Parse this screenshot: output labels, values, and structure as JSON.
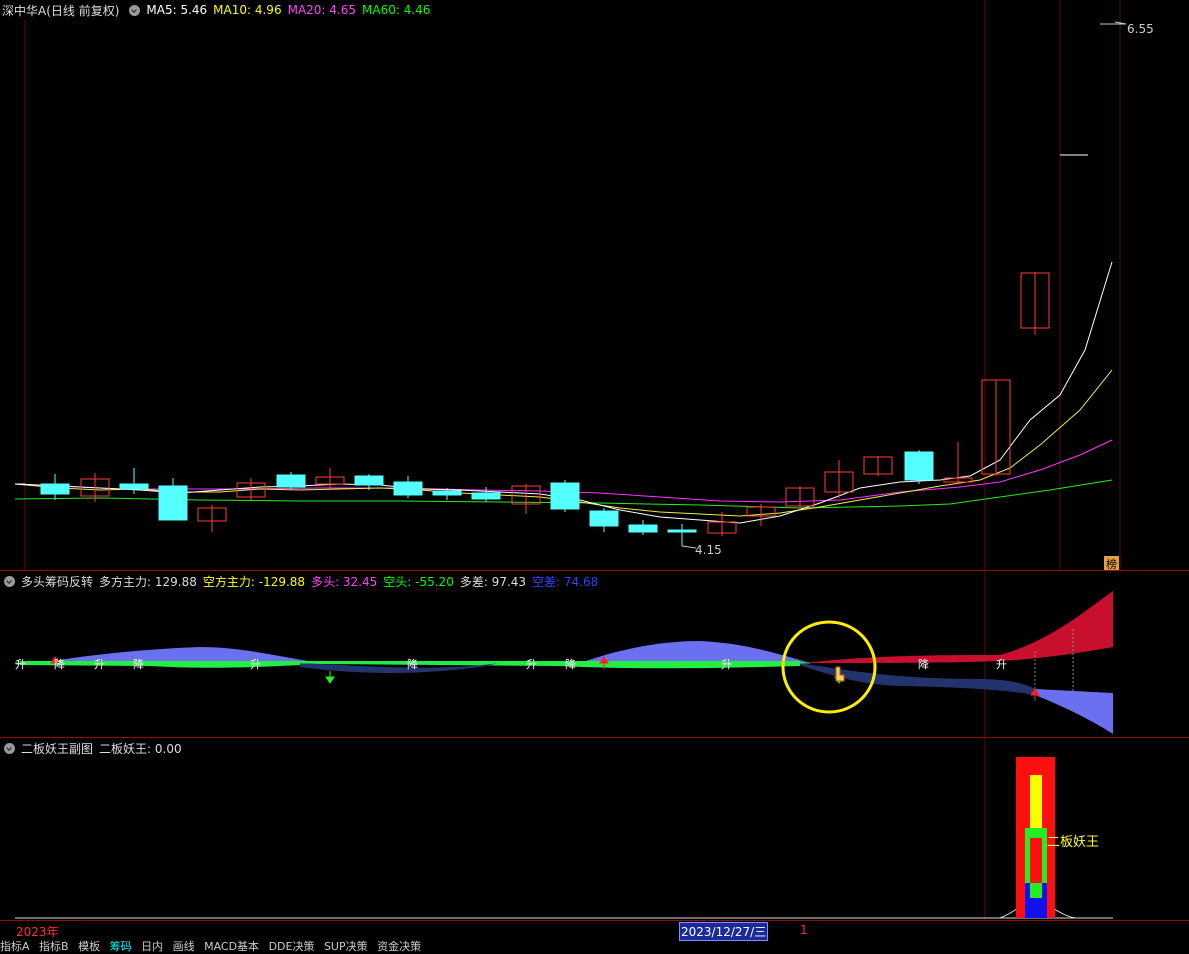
{
  "main_header": {
    "title": "深中华A(日线 前复权)",
    "ma5": "MA5: 5.46",
    "ma10": "MA10: 4.96",
    "ma20": "MA20: 4.65",
    "ma60": "MA60: 4.46"
  },
  "price_high_label": "6.55",
  "price_low_label": "4.15",
  "badge_label": "榜",
  "indicator1_header": {
    "title": "多头筹码反转",
    "duo_zhuli": "多方主力: 129.88",
    "kong_zhuli": "空方主力: -129.88",
    "duotou": "多头: 32.45",
    "kongtou": "空头: -55.20",
    "duocha": "多差: 97.43",
    "kongcha": "空差: 74.68"
  },
  "indicator2_header": {
    "title": "二板妖王副图",
    "value": "二板妖王: 0.00"
  },
  "erban_label": "二板妖王",
  "sheng_label": "升",
  "jiang_label": "降",
  "footer": {
    "year": "2023年",
    "date": "2023/12/27/三",
    "cursor": "1"
  },
  "tabs": [
    "指标A",
    "指标B",
    "模板",
    "筹码",
    "日内",
    "画线",
    "MACD基本",
    "DDE决策",
    "SUP决策",
    "资金决策"
  ],
  "colors": {
    "up_candle": "#ff3c3c",
    "down_candle": "#54ffff",
    "ma5": "#ffffff",
    "ma10": "#ffff00",
    "ma20": "#ff00ff",
    "ma60": "#00ff00",
    "grid": "#6e0d0d"
  }
}
